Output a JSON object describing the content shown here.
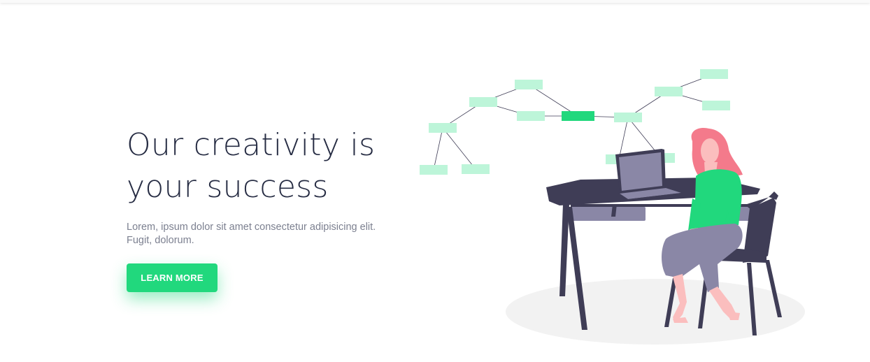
{
  "hero": {
    "title_line1": "Our creativity is",
    "title_line2": "your success",
    "subtitle_line1": "Lorem, ipsum dolor sit amet consectetur adipisicing elit.",
    "subtitle_line2": "Fugit, dolorum.",
    "cta_label": "LEARN MORE"
  },
  "colors": {
    "accent": "#21d87d",
    "node_light": "#bdf5d9",
    "dark": "#3f3d56",
    "text_dark": "#262c43",
    "hair": "#f47a8b"
  },
  "illustration": {
    "name": "woman-working-at-desk-illustration"
  }
}
